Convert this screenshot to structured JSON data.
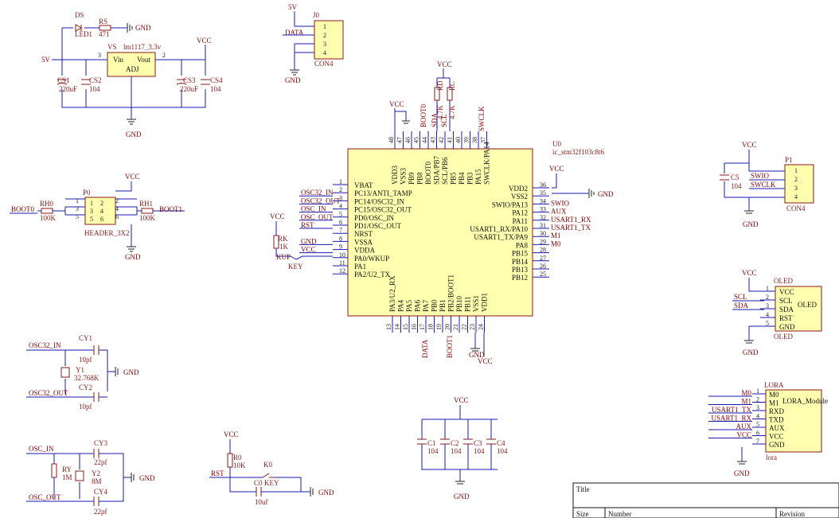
{
  "power_labels": {
    "gnd": "GND",
    "vcc": "VCC",
    "v5": "5V"
  },
  "regulator": {
    "led_ref": "DS",
    "led_val": "LED1",
    "rs_ref": "RS",
    "rs_val": "471",
    "vs_ref": "VS",
    "vs_val": "lm1117_3.3v",
    "vin": "Vin",
    "vout": "Vout",
    "adj": "ADJ",
    "pin3": "3",
    "pin2": "2",
    "cs1": "CS1",
    "cs1_val": "220uF",
    "cs2": "CS2",
    "cs2_val": "104",
    "cs3": "CS3",
    "cs3_val": "220uF",
    "cs4": "CS4",
    "cs4_val": "104"
  },
  "j0": {
    "ref": "J0",
    "name": "CON4",
    "data_net": "DATA",
    "pins": [
      "1",
      "2",
      "3",
      "4"
    ]
  },
  "p0": {
    "ref": "P0",
    "name": "HEADER_3X2",
    "rh0": "RH0",
    "rh0_val": "100K",
    "rh1": "RH1",
    "rh1_val": "100K",
    "boot0": "BOOT0",
    "boot1": "BOOT1",
    "pins_left": [
      "1",
      "3",
      "5"
    ],
    "pins_right": [
      "2",
      "4",
      "6"
    ],
    "inner_left": [
      "1",
      "3",
      "5"
    ],
    "inner_right": [
      "2",
      "4",
      "6"
    ]
  },
  "mcu": {
    "ref": "U0",
    "part": "ic_stm32f103c8t6",
    "left_pins": [
      {
        "num": "1",
        "name": "VBAT",
        "net": ""
      },
      {
        "num": "2",
        "name": "PC13/ANTI_TAMP",
        "net": "OSC32_IN"
      },
      {
        "num": "3",
        "name": "PC14/OSC32_IN",
        "net": "OSC32_OUT"
      },
      {
        "num": "4",
        "name": "PC15/OSC32_OUT",
        "net": "OSC_IN"
      },
      {
        "num": "5",
        "name": "PD0/OSC_IN",
        "net": "OSC_OUT"
      },
      {
        "num": "6",
        "name": "PD1/OSC_OUT",
        "net": "RST"
      },
      {
        "num": "7",
        "name": "NRST",
        "net": ""
      },
      {
        "num": "8",
        "name": "VSSA",
        "net": "GND"
      },
      {
        "num": "9",
        "name": "VDDA",
        "net": "VCC"
      },
      {
        "num": "10",
        "name": "PA0/WKUP",
        "net": ""
      },
      {
        "num": "11",
        "name": "PA1",
        "net": ""
      },
      {
        "num": "12",
        "name": "PA2/U2_TX",
        "net": ""
      }
    ],
    "right_pins": [
      {
        "num": "36",
        "name": "VDD2",
        "net": ""
      },
      {
        "num": "35",
        "name": "VSS2",
        "net": ""
      },
      {
        "num": "34",
        "name": "SWIO/PA13",
        "net": "SWIO"
      },
      {
        "num": "33",
        "name": "PA12",
        "net": "AUX"
      },
      {
        "num": "32",
        "name": "PA11",
        "net": "USART1_RX"
      },
      {
        "num": "31",
        "name": "USART1_RX/PA10",
        "net": "USART1_TX"
      },
      {
        "num": "30",
        "name": "USART1_TX/PA9",
        "net": "M1"
      },
      {
        "num": "29",
        "name": "PA8",
        "net": "M0"
      },
      {
        "num": "28",
        "name": "PB15",
        "net": ""
      },
      {
        "num": "27",
        "name": "PB14",
        "net": ""
      },
      {
        "num": "26",
        "name": "PB13",
        "net": ""
      },
      {
        "num": "25",
        "name": "PB12",
        "net": ""
      }
    ],
    "top_pins": [
      {
        "num": "48",
        "name": "VDD3"
      },
      {
        "num": "47",
        "name": "VSS3"
      },
      {
        "num": "46",
        "name": "PB9"
      },
      {
        "num": "45",
        "name": "PB8"
      },
      {
        "num": "44",
        "name": "BOOT0"
      },
      {
        "num": "43",
        "name": "SDA/PB7"
      },
      {
        "num": "42",
        "name": "SCL/PB6"
      },
      {
        "num": "41",
        "name": "PB5"
      },
      {
        "num": "40",
        "name": "PB4"
      },
      {
        "num": "39",
        "name": "PB3"
      },
      {
        "num": "38",
        "name": "PA15"
      },
      {
        "num": "37",
        "name": "SWCLK/PA14"
      }
    ],
    "bottom_pins": [
      {
        "num": "13",
        "name": "PA3/U2_RX"
      },
      {
        "num": "14",
        "name": "PA4"
      },
      {
        "num": "15",
        "name": "PA5"
      },
      {
        "num": "16",
        "name": "PA6"
      },
      {
        "num": "17",
        "name": "PA7"
      },
      {
        "num": "18",
        "name": "PB0"
      },
      {
        "num": "19",
        "name": "PB1"
      },
      {
        "num": "20",
        "name": "PB2/BOOT1"
      },
      {
        "num": "21",
        "name": "PB10"
      },
      {
        "num": "22",
        "name": "PB11"
      },
      {
        "num": "23",
        "name": "VSS1"
      },
      {
        "num": "24",
        "name": "VDD1"
      }
    ],
    "top_nets": {
      "boot0": "BOOT0",
      "sda": "SDA",
      "scl": "SCL",
      "swclk": "SWCLK"
    },
    "rd": "RD",
    "rd_val": "4.7K",
    "rc": "RC",
    "rc_val": "4.7K",
    "bottom_nets": {
      "data": "DATA",
      "boot1": "BOOT1"
    }
  },
  "reset": {
    "rk": "RK",
    "rk_val": "1K",
    "kup": "KUP",
    "key": "KEY"
  },
  "p1": {
    "ref": "P1",
    "name": "CON4",
    "c5": "C5",
    "c5_val": "104",
    "swio": "SWIO",
    "swclk": "SWCLK",
    "pins": [
      "1",
      "2",
      "3",
      "4"
    ]
  },
  "oled": {
    "ref": "OLED",
    "name": "OLED",
    "footer": "OLED",
    "pins": [
      {
        "num": "1",
        "name": "VCC"
      },
      {
        "num": "2",
        "name": "SCL"
      },
      {
        "num": "3",
        "name": "SDA"
      },
      {
        "num": "4",
        "name": "RST"
      },
      {
        "num": "5",
        "name": "GND"
      }
    ],
    "nets": {
      "scl": "SCL",
      "sda": "SDA"
    }
  },
  "lora": {
    "ref": "LORA",
    "name": "LORA_Module",
    "footer": "lora",
    "pins": [
      {
        "num": "1",
        "name": "M0",
        "net": "M0"
      },
      {
        "num": "2",
        "name": "M1",
        "net": "M1"
      },
      {
        "num": "3",
        "name": "RXD",
        "net": "USART1_TX"
      },
      {
        "num": "4",
        "name": "TXD",
        "net": "USART1_RX"
      },
      {
        "num": "5",
        "name": "AUX",
        "net": "AUX"
      },
      {
        "num": "6",
        "name": "VCC",
        "net": "VCC"
      },
      {
        "num": "7",
        "name": "GND",
        "net": ""
      }
    ]
  },
  "crystal32": {
    "in_net": "OSC32_IN",
    "out_net": "OSC32_OUT",
    "cy1": "CY1",
    "cy1_val": "10pf",
    "y1": "Y1",
    "y1_val": "32.768K",
    "cy2": "CY2",
    "cy2_val": "10pf"
  },
  "crystal8": {
    "in_net": "OSC_IN",
    "out_net": "OSC_OUT",
    "cy3": "CY3",
    "cy3_val": "22pf",
    "ry": "RY",
    "ry_val": "1M",
    "y2": "Y2",
    "y2_val": "8M",
    "cy4": "CY4",
    "cy4_val": "22pf"
  },
  "key0": {
    "r0": "R0",
    "r0_val": "10K",
    "k0": "K0",
    "rst_net": "RST",
    "c0": "C0",
    "c0_val": "10uf",
    "key": "KEY"
  },
  "decoupling": {
    "caps": [
      {
        "ref": "C1",
        "val": "104"
      },
      {
        "ref": "C2",
        "val": "104"
      },
      {
        "ref": "C3",
        "val": "104"
      },
      {
        "ref": "C4",
        "val": "104"
      }
    ]
  },
  "title_block": {
    "title": "Title",
    "size": "Size",
    "number": "Number",
    "revision": "Revision"
  }
}
